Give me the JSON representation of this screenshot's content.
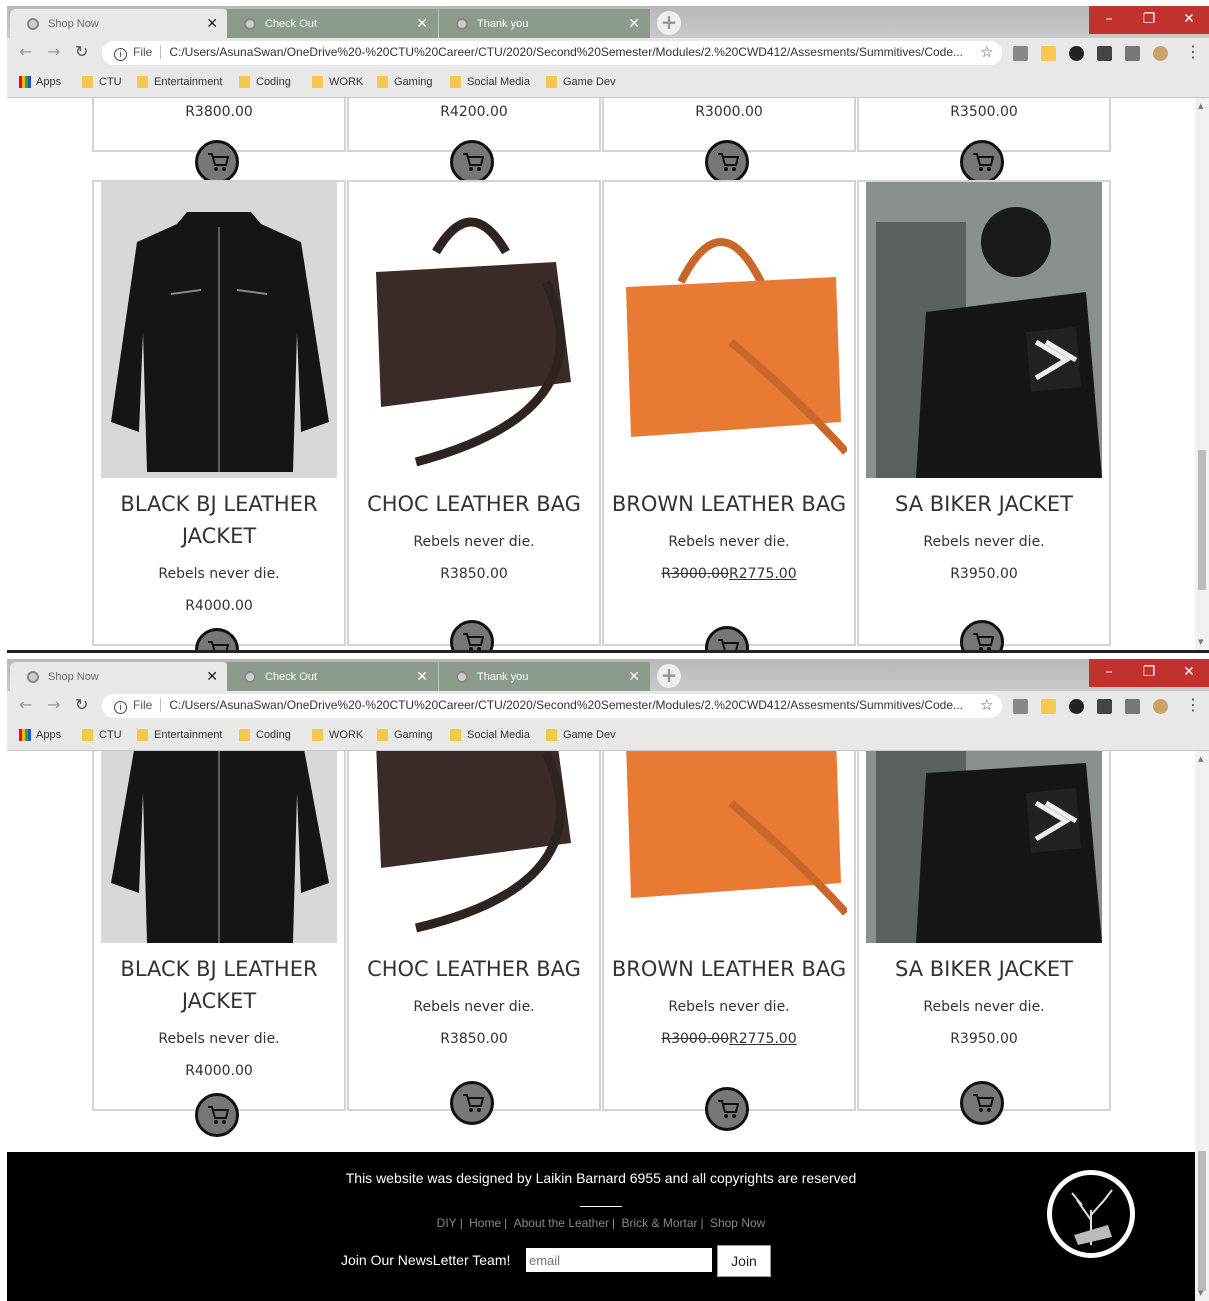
{
  "browser": {
    "tabs": [
      {
        "label": "Shop Now",
        "state": "active"
      },
      {
        "label": "Check Out",
        "state": "inactive"
      },
      {
        "label": "Thank you",
        "state": "inactive"
      }
    ],
    "new_tab": "+",
    "window_controls": [
      "–",
      "❐",
      "✕"
    ],
    "url_prefix": "File",
    "url": "C:/Users/AsunaSwan/OneDrive%20-%20CTU%20Career/CTU/2020/Second%20Semester/Modules/2.%20CWD412/Assesments/Summitives/Code...",
    "bookmarks": [
      "Apps",
      "CTU",
      "Entertainment",
      "Coding",
      "WORK",
      "Gaming",
      "Social Media",
      "Game Dev"
    ]
  },
  "top_row_prices": [
    "R3800.00",
    "R4200.00",
    "R3000.00",
    "R3500.00"
  ],
  "products": [
    {
      "name_line1": "BLACK BJ LEATHER",
      "name_line2": "JACKET",
      "tagline": "Rebels never die.",
      "price": "R4000.00",
      "old_price": "",
      "image": "black-leather-jacket"
    },
    {
      "name_line1": "CHOC LEATHER BAG",
      "name_line2": "",
      "tagline": "Rebels never die.",
      "price": "R3850.00",
      "old_price": "",
      "image": "chocolate-leather-bag"
    },
    {
      "name_line1": "BROWN LEATHER BAG",
      "name_line2": "",
      "tagline": "Rebels never die.",
      "price": "R2775.00",
      "old_price": "R3000.00",
      "image": "brown-leather-bag"
    },
    {
      "name_line1": "SA BIKER JACKET",
      "name_line2": "",
      "tagline": "Rebels never die.",
      "price": "R3950.00",
      "old_price": "",
      "image": "biker-jacket-model"
    }
  ],
  "footer": {
    "credit": "This website was designed by Laikin Barnard 6955 and all copyrights are reserved",
    "links": [
      "DIY",
      "Home",
      "About the Leather",
      "Brick & Mortar",
      "Shop Now"
    ],
    "newsletter_label": "Join Our NewsLetter Team!",
    "email_placeholder": "email",
    "join_label": "Join"
  },
  "colors": {
    "accent_close": "#c1312e",
    "footer_bg": "#000000",
    "card_border": "#d4d4d4",
    "cart_fill": "#777777"
  }
}
